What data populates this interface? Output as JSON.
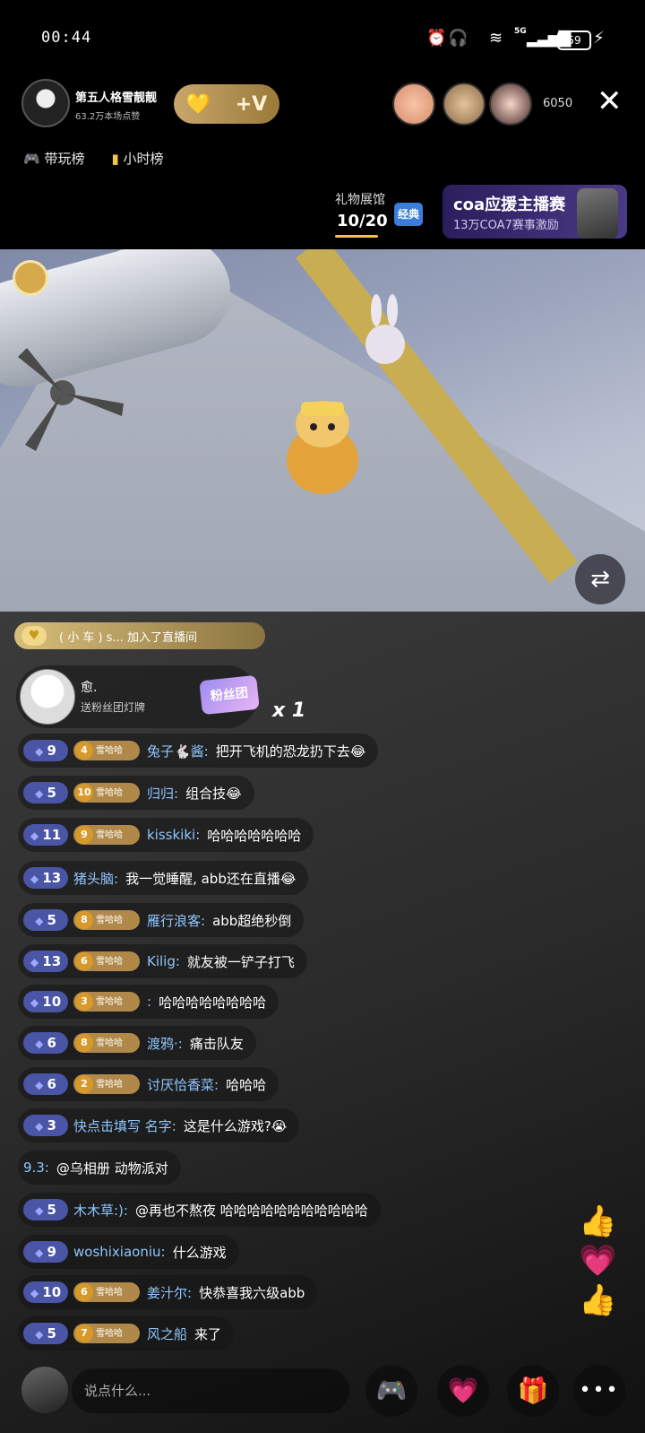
{
  "status_bar": {
    "time": "00:44",
    "network": "5G",
    "battery": "59"
  },
  "header": {
    "streamer_name": "第五人格雪靓靓",
    "likes_text": "63.2万本场点赞",
    "viewer_count": "6050",
    "tabs": [
      {
        "label": "带玩榜"
      },
      {
        "label": "小时榜"
      }
    ]
  },
  "gift_hall": {
    "title": "礼物展馆",
    "progress": "10/20",
    "badge": "经典"
  },
  "promo": {
    "title": "coa应援主播赛",
    "subtitle": "13万COA7赛事激励"
  },
  "join_banner": {
    "text": "( 小 车 ) s... 加入了直播间"
  },
  "fan_card": {
    "name": "愈.",
    "desc": "送粉丝团灯牌",
    "badge": "粉丝团",
    "count": "x 1"
  },
  "chat": [
    {
      "level": "9",
      "fan_level": "4",
      "fan_name": "雪哈哈",
      "user": "兔子🐇酱:",
      "text": "把开飞机的恐龙扔下去😂"
    },
    {
      "level": "5",
      "fan_level": "10",
      "fan_name": "雪哈哈",
      "user": "归归:",
      "text": "组合技😂"
    },
    {
      "level": "11",
      "fan_level": "9",
      "fan_name": "雪哈哈",
      "user": "kisskiki:",
      "text": "哈哈哈哈哈哈哈"
    },
    {
      "level": "13",
      "user": "猪头脑:",
      "text": "我一觉睡醒, abb还在直播😂"
    },
    {
      "level": "5",
      "fan_level": "8",
      "fan_name": "雪哈哈",
      "user": "雁行浪客:",
      "text": "abb超绝秒倒"
    },
    {
      "level": "13",
      "fan_level": "6",
      "fan_name": "雪哈哈",
      "user": "Kilig:",
      "text": "就友被一铲子打飞"
    },
    {
      "level": "10",
      "fan_level": "3",
      "fan_name": "雪哈哈",
      "user": ":",
      "text": "哈哈哈哈哈哈哈哈"
    },
    {
      "level": "6",
      "fan_level": "8",
      "fan_name": "雪哈哈",
      "user": "渡鸦·:",
      "text": "痛击队友"
    },
    {
      "level": "6",
      "fan_level": "2",
      "fan_name": "雪哈哈",
      "user": "讨厌恰香菜:",
      "text": "哈哈哈"
    },
    {
      "level": "3",
      "user": "快点击填写 名字:",
      "text": "这是什么游戏?😭"
    },
    {
      "user": "9.3:",
      "text": "@乌相册 动物派对"
    },
    {
      "level": "5",
      "user": "木木草:):",
      "text": "@再也不熬夜 哈哈哈哈哈哈哈哈哈哈哈"
    },
    {
      "level": "9",
      "user": "woshixiaoniu:",
      "text": "什么游戏"
    },
    {
      "level": "10",
      "fan_level": "6",
      "fan_name": "雪哈哈",
      "user": "姜汁尔:",
      "text": "快恭喜我六级abb"
    },
    {
      "level": "5",
      "fan_level": "7",
      "fan_name": "雪哈哈",
      "user": "风之船",
      "text": "来了"
    }
  ],
  "bottom": {
    "placeholder": "说点什么..."
  },
  "icons": {
    "close": "close-icon",
    "gamepad": "gamepad-icon",
    "chart": "bar-chart-icon",
    "rotate": "rotate-screen-icon",
    "game_button": "game-controller-icon",
    "heart_button": "heart-icon",
    "gift_button": "gift-icon",
    "more_button": "more-icon",
    "like_float": "thumbs-up-icon"
  }
}
